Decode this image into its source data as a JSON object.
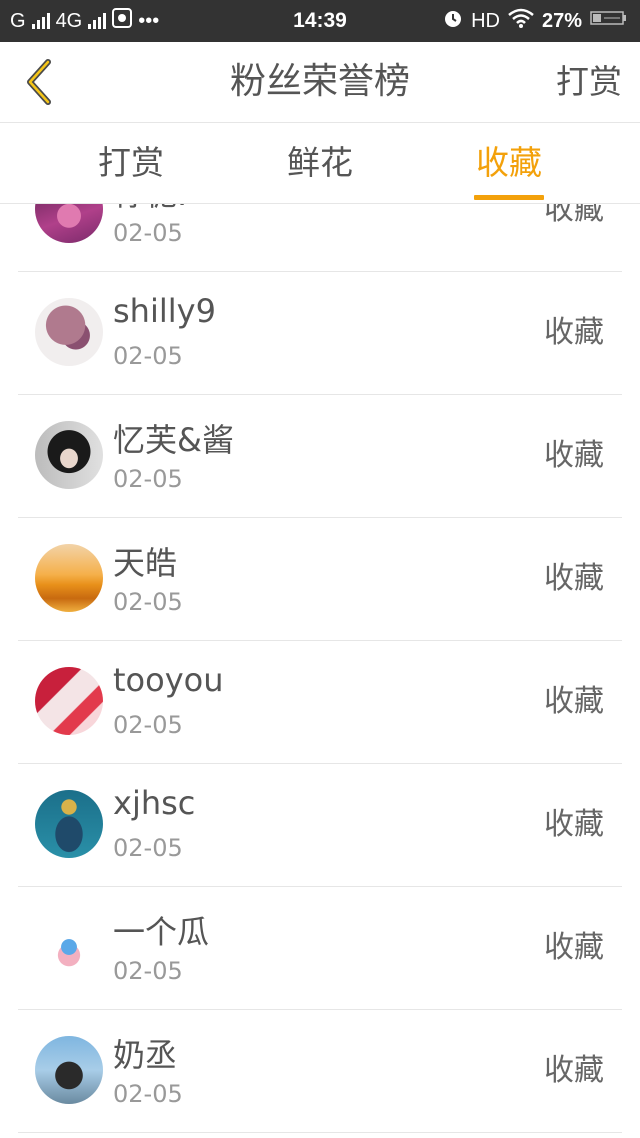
{
  "status_bar": {
    "carrier1": "G",
    "carrier2": "4G",
    "more": "•••",
    "time": "14:39",
    "hd": "HD",
    "battery": "27%"
  },
  "nav": {
    "title": "粉丝荣誉榜",
    "action": "打赏"
  },
  "tabs": [
    {
      "label": "打赏",
      "active": false
    },
    {
      "label": "鲜花",
      "active": false
    },
    {
      "label": "收藏",
      "active": true
    }
  ],
  "colors": {
    "accent": "#f3a10b",
    "statusbar": "#333333",
    "text": "#555555",
    "subtext": "#999999"
  },
  "list": [
    {
      "name": "柠栀.*",
      "date": "02-05",
      "type": "收藏"
    },
    {
      "name": "shilly9",
      "date": "02-05",
      "type": "收藏"
    },
    {
      "name": "忆芙&酱",
      "date": "02-05",
      "type": "收藏"
    },
    {
      "name": "天皓",
      "date": "02-05",
      "type": "收藏"
    },
    {
      "name": "tooyou",
      "date": "02-05",
      "type": "收藏"
    },
    {
      "name": "xjhsc",
      "date": "02-05",
      "type": "收藏"
    },
    {
      "name": "一个瓜",
      "date": "02-05",
      "type": "收藏"
    },
    {
      "name": "奶丞",
      "date": "02-05",
      "type": "收藏"
    }
  ]
}
